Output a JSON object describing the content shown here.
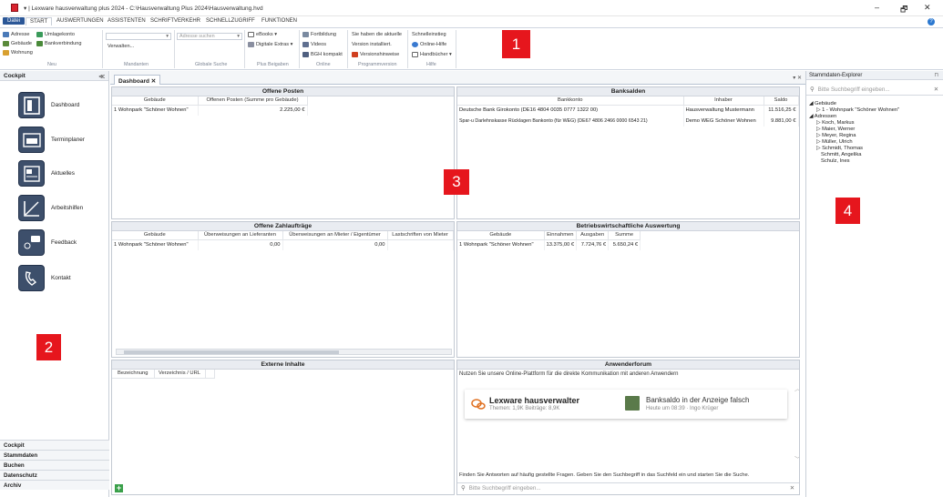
{
  "window": {
    "title": "▾  |  Lexware hausverwaltung plus 2024 - C:\\Hausverwaltung Plus 2024\\Hausverwaltung.hvd",
    "minimize": "–",
    "maximize": "🗗",
    "close": "✕"
  },
  "ribbon_tabs": {
    "file": "Datei",
    "start": "START",
    "auswertungen": "AUSWERTUNGEN",
    "assistenten": "ASSISTENTEN",
    "schriftverkehr": "SCHRIFTVERKEHR",
    "schnellzugriff": "SCHNELLZUGRIFF",
    "funktionen": "FUNKTIONEN"
  },
  "ribbon": {
    "adresse": "Adresse",
    "umlagekonto": "Umlagekonto",
    "gebaeude": "Gebäude",
    "bankverbindung": "Bankverbindung",
    "wohnung": "Wohnung",
    "group_neu": "Neu",
    "verwalten": "Verwalten...",
    "group_mandanten": "Mandanten",
    "adresse_suchen_placeholder": "Adresse suchen",
    "group_globale_suche": "Globale Suche",
    "ebooks": "eBooks ▾",
    "digitale_extras": "Digitale Extras ▾",
    "group_plus": "Plus Beigaben",
    "fortbildung": "Fortbildung",
    "videos": "Videos",
    "bgh": "BGH kompakt",
    "group_online": "Online",
    "version_line1": "Sie haben die aktuelle",
    "version_line2": "Version installiert.",
    "versionshinweise": "Versionshinweise",
    "group_programmversion": "Programmversion",
    "schnelleinstieg": "Schnelleinstieg",
    "online_hilfe": "Online-Hilfe",
    "handbuecher": "Handbücher ▾",
    "group_hilfe": "Hilfe"
  },
  "markers": {
    "m1": "1",
    "m2": "2",
    "m3": "3",
    "m4": "4"
  },
  "cockpit": {
    "title": "Cockpit",
    "collapse": "≪",
    "items": [
      {
        "label": "Dashboard"
      },
      {
        "label": "Terminplaner"
      },
      {
        "label": "Aktuelles"
      },
      {
        "label": "Arbeitshilfen"
      },
      {
        "label": "Feedback"
      },
      {
        "label": "Kontakt"
      }
    ],
    "nav": [
      "Cockpit",
      "Stammdaten",
      "Buchen",
      "Datenschutz",
      "Archiv"
    ]
  },
  "doc_tab": {
    "label": "Dashboard",
    "close": "✕"
  },
  "center_controls": "▾ ✕",
  "offene_posten": {
    "title": "Offene Posten",
    "headers": [
      "Gebäude",
      "Offenen Posten (Summe pro Gebäude)"
    ],
    "rows": [
      [
        "1 Wohnpark \"Schöner Wohnen\"",
        "2.225,00 €"
      ]
    ]
  },
  "banksalden": {
    "title": "Banksalden",
    "headers": [
      "Bankkonto",
      "Inhaber",
      "Saldo"
    ],
    "rows": [
      [
        "Deutsche Bank Girokonto (DE16 4804 0035 0777 1322 00)",
        "Hausverwaltung Mustermann",
        "11.516,25 €"
      ],
      [
        "Spar-u Darlehnskasse Rücklagen Bankonto  (für WEG) (DE67 4806 2466 0000 6543 21)",
        "Demo WEG Schöner Wohnen",
        "9.881,00 €"
      ]
    ]
  },
  "zahlauftraege": {
    "title": "Offene Zahlaufträge",
    "headers": [
      "Gebäude",
      "Überweisungen an Lieferanten",
      "Überweisungen an Mieter / Eigentümer",
      "Lastschriften von Mieter"
    ],
    "rows": [
      [
        "1 Wohnpark \"Schöner Wohnen\"",
        "0,00",
        "0,00",
        ""
      ]
    ]
  },
  "bwa": {
    "title": "Betriebswirtschaftliche Auswertung",
    "headers": [
      "Gebäude",
      "Einnahmen",
      "Ausgaben",
      "Summe"
    ],
    "rows": [
      [
        "1 Wohnpark \"Schöner Wohnen\"",
        "13.375,00 €",
        "7.724,76 €",
        "5.650,24 €"
      ]
    ]
  },
  "externe": {
    "title": "Externe Inhalte",
    "headers": [
      "Bezeichnung",
      "Verzeichnis / URL"
    ],
    "add": "+"
  },
  "forum": {
    "title": "Anwenderforum",
    "intro": "Nutzen Sie unsere Online-Plattform für die direkte Kommunikation mit anderen Anwendern",
    "brand": "Lexware hausverwalter",
    "stats": "Themen: 1,9K  Beiträge: 8,9K",
    "post_title": "Banksaldo in der Anzeige falsch",
    "post_meta": "Heute um 08:39 · Ingo Krüger",
    "footer": "Finden Sie Antworten auf häufig gestellte Fragen. Geben Sie den Suchbegriff in das Suchfeld ein und starten Sie die Suche.",
    "search_placeholder": "Bitte Suchbegriff eingeben...",
    "search_clear": "✕"
  },
  "explorer": {
    "title": "Stammdaten-Explorer",
    "pin": "⊓",
    "search_placeholder": "Bitte Suchbegriff eingeben...",
    "clear": "✕",
    "tree": {
      "gebaeude": "◢ Gebäude",
      "wohnpark": "▷ 1 - Wohnpark \"Schöner Wohnen\"",
      "adressen": "◢ Adressen",
      "people": [
        {
          "label": "▷ Koch, Markus"
        },
        {
          "label": "▷ Maier, Werner"
        },
        {
          "label": "▷ Meyer, Regina"
        },
        {
          "label": "▷ Müller, Ulrich"
        },
        {
          "label": "▷ Schmidt, Thomas"
        },
        {
          "label": "Schmitt, Angelika"
        },
        {
          "label": "Schulz, Ines"
        }
      ]
    }
  },
  "colors": {
    "accent": "#2b5797",
    "marker": "#e6161d",
    "tile": "#3d4f6b"
  }
}
